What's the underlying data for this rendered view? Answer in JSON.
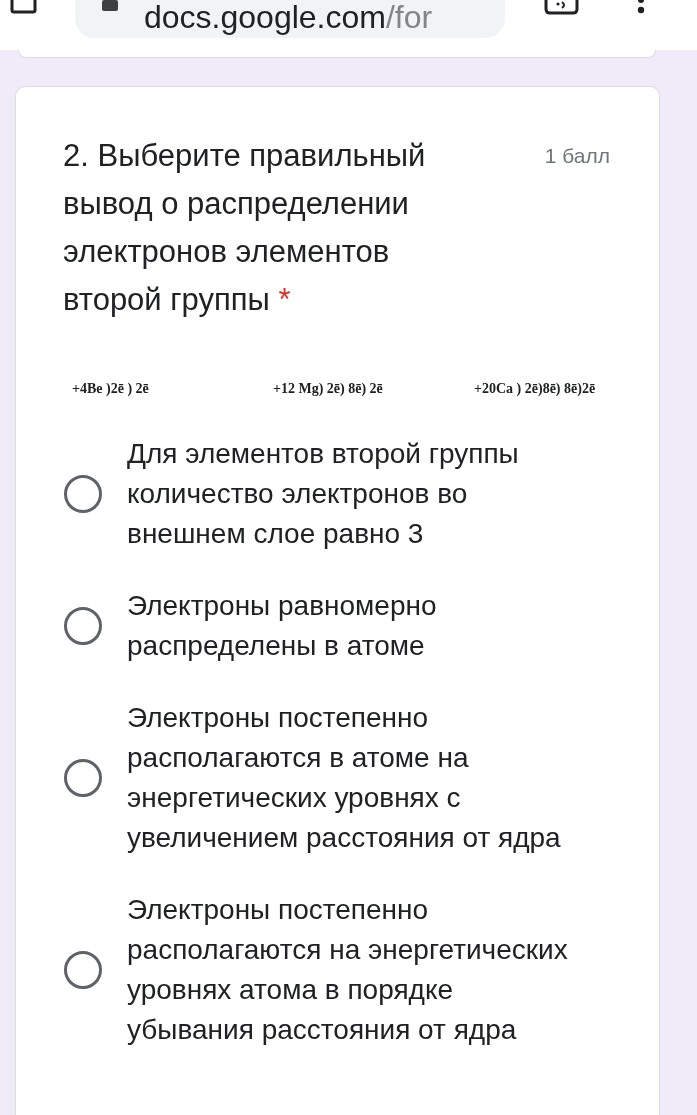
{
  "browser": {
    "url_domain": "docs.google.com",
    "url_path": "/for"
  },
  "question": {
    "title": "2. Выберите правильный вывод о распределении электронов элементов второй группы",
    "required_mark": "*",
    "points": "1 балл",
    "formulas": [
      "+4Be )2ē ) 2ē",
      "+12 Mg) 2ē) 8ē) 2ē",
      "+20Ca ) 2ē)8ē) 8ē)2ē"
    ],
    "options": [
      {
        "label": "Для элементов второй группы количество электронов во внешнем слое равно 3",
        "selected": false
      },
      {
        "label": "Электроны равномерно распределены в атоме",
        "selected": false
      },
      {
        "label": "Электроны постепенно располагаются в атоме на энергетических уровнях с увеличением расстояния от ядра",
        "selected": false
      },
      {
        "label": "Электроны постепенно располагаются на энергетических уровнях атома в порядке убывания расстояния от ядра",
        "selected": false
      }
    ]
  }
}
